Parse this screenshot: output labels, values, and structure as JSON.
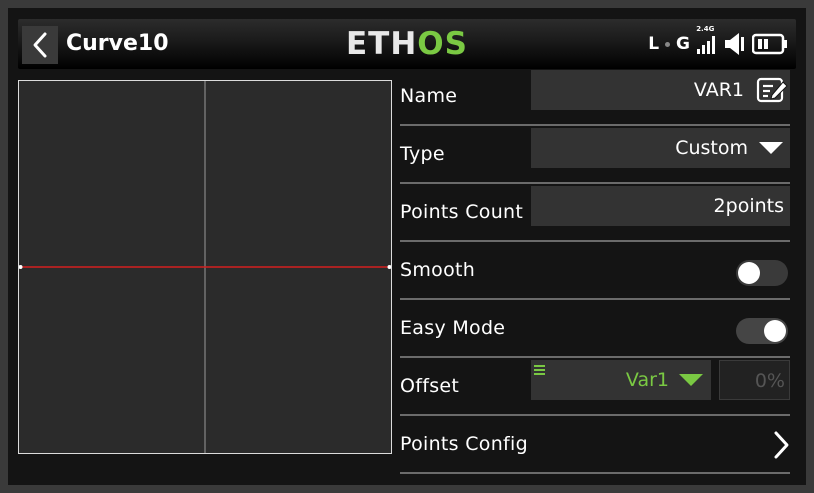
{
  "header": {
    "title": "Curve10",
    "logo_main": "ETH",
    "logo_accent": "OS",
    "status": {
      "telemetry_letter": "L",
      "gps_letter": "G",
      "band_label": "2.4G",
      "icons": [
        "signal-bars-icon",
        "volume-icon",
        "battery-icon"
      ]
    }
  },
  "settings": {
    "name": {
      "label": "Name",
      "value": "VAR1"
    },
    "type": {
      "label": "Type",
      "value": "Custom"
    },
    "points_count": {
      "label": "Points Count",
      "value": "2points"
    },
    "smooth": {
      "label": "Smooth",
      "on": false
    },
    "easy_mode": {
      "label": "Easy Mode",
      "on": true
    },
    "offset": {
      "label": "Offset",
      "source": "Var1",
      "value": "0%"
    },
    "points_config": {
      "label": "Points Config"
    }
  },
  "curve": {
    "points": [
      {
        "x": -100,
        "y": 0
      },
      {
        "x": 100,
        "y": 0
      }
    ],
    "x_range": [
      -100,
      100
    ],
    "y_range": [
      -100,
      100
    ]
  },
  "colors": {
    "accent": "#7ac943",
    "curve_line": "#d42020",
    "background": "#141414",
    "field_bg": "#333333"
  }
}
